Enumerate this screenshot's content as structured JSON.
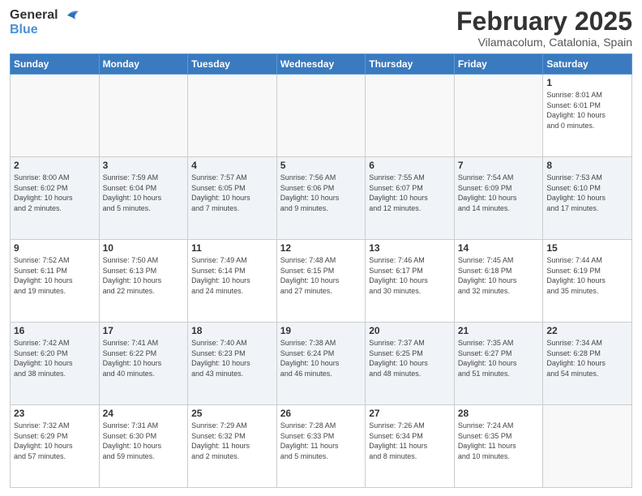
{
  "header": {
    "logo_line1": "General",
    "logo_line2": "Blue",
    "month_title": "February 2025",
    "location": "Vilamacolum, Catalonia, Spain"
  },
  "weekdays": [
    "Sunday",
    "Monday",
    "Tuesday",
    "Wednesday",
    "Thursday",
    "Friday",
    "Saturday"
  ],
  "weeks": [
    [
      {
        "day": "",
        "info": ""
      },
      {
        "day": "",
        "info": ""
      },
      {
        "day": "",
        "info": ""
      },
      {
        "day": "",
        "info": ""
      },
      {
        "day": "",
        "info": ""
      },
      {
        "day": "",
        "info": ""
      },
      {
        "day": "1",
        "info": "Sunrise: 8:01 AM\nSunset: 6:01 PM\nDaylight: 10 hours\nand 0 minutes."
      }
    ],
    [
      {
        "day": "2",
        "info": "Sunrise: 8:00 AM\nSunset: 6:02 PM\nDaylight: 10 hours\nand 2 minutes."
      },
      {
        "day": "3",
        "info": "Sunrise: 7:59 AM\nSunset: 6:04 PM\nDaylight: 10 hours\nand 5 minutes."
      },
      {
        "day": "4",
        "info": "Sunrise: 7:57 AM\nSunset: 6:05 PM\nDaylight: 10 hours\nand 7 minutes."
      },
      {
        "day": "5",
        "info": "Sunrise: 7:56 AM\nSunset: 6:06 PM\nDaylight: 10 hours\nand 9 minutes."
      },
      {
        "day": "6",
        "info": "Sunrise: 7:55 AM\nSunset: 6:07 PM\nDaylight: 10 hours\nand 12 minutes."
      },
      {
        "day": "7",
        "info": "Sunrise: 7:54 AM\nSunset: 6:09 PM\nDaylight: 10 hours\nand 14 minutes."
      },
      {
        "day": "8",
        "info": "Sunrise: 7:53 AM\nSunset: 6:10 PM\nDaylight: 10 hours\nand 17 minutes."
      }
    ],
    [
      {
        "day": "9",
        "info": "Sunrise: 7:52 AM\nSunset: 6:11 PM\nDaylight: 10 hours\nand 19 minutes."
      },
      {
        "day": "10",
        "info": "Sunrise: 7:50 AM\nSunset: 6:13 PM\nDaylight: 10 hours\nand 22 minutes."
      },
      {
        "day": "11",
        "info": "Sunrise: 7:49 AM\nSunset: 6:14 PM\nDaylight: 10 hours\nand 24 minutes."
      },
      {
        "day": "12",
        "info": "Sunrise: 7:48 AM\nSunset: 6:15 PM\nDaylight: 10 hours\nand 27 minutes."
      },
      {
        "day": "13",
        "info": "Sunrise: 7:46 AM\nSunset: 6:17 PM\nDaylight: 10 hours\nand 30 minutes."
      },
      {
        "day": "14",
        "info": "Sunrise: 7:45 AM\nSunset: 6:18 PM\nDaylight: 10 hours\nand 32 minutes."
      },
      {
        "day": "15",
        "info": "Sunrise: 7:44 AM\nSunset: 6:19 PM\nDaylight: 10 hours\nand 35 minutes."
      }
    ],
    [
      {
        "day": "16",
        "info": "Sunrise: 7:42 AM\nSunset: 6:20 PM\nDaylight: 10 hours\nand 38 minutes."
      },
      {
        "day": "17",
        "info": "Sunrise: 7:41 AM\nSunset: 6:22 PM\nDaylight: 10 hours\nand 40 minutes."
      },
      {
        "day": "18",
        "info": "Sunrise: 7:40 AM\nSunset: 6:23 PM\nDaylight: 10 hours\nand 43 minutes."
      },
      {
        "day": "19",
        "info": "Sunrise: 7:38 AM\nSunset: 6:24 PM\nDaylight: 10 hours\nand 46 minutes."
      },
      {
        "day": "20",
        "info": "Sunrise: 7:37 AM\nSunset: 6:25 PM\nDaylight: 10 hours\nand 48 minutes."
      },
      {
        "day": "21",
        "info": "Sunrise: 7:35 AM\nSunset: 6:27 PM\nDaylight: 10 hours\nand 51 minutes."
      },
      {
        "day": "22",
        "info": "Sunrise: 7:34 AM\nSunset: 6:28 PM\nDaylight: 10 hours\nand 54 minutes."
      }
    ],
    [
      {
        "day": "23",
        "info": "Sunrise: 7:32 AM\nSunset: 6:29 PM\nDaylight: 10 hours\nand 57 minutes."
      },
      {
        "day": "24",
        "info": "Sunrise: 7:31 AM\nSunset: 6:30 PM\nDaylight: 10 hours\nand 59 minutes."
      },
      {
        "day": "25",
        "info": "Sunrise: 7:29 AM\nSunset: 6:32 PM\nDaylight: 11 hours\nand 2 minutes."
      },
      {
        "day": "26",
        "info": "Sunrise: 7:28 AM\nSunset: 6:33 PM\nDaylight: 11 hours\nand 5 minutes."
      },
      {
        "day": "27",
        "info": "Sunrise: 7:26 AM\nSunset: 6:34 PM\nDaylight: 11 hours\nand 8 minutes."
      },
      {
        "day": "28",
        "info": "Sunrise: 7:24 AM\nSunset: 6:35 PM\nDaylight: 11 hours\nand 10 minutes."
      },
      {
        "day": "",
        "info": ""
      }
    ]
  ]
}
